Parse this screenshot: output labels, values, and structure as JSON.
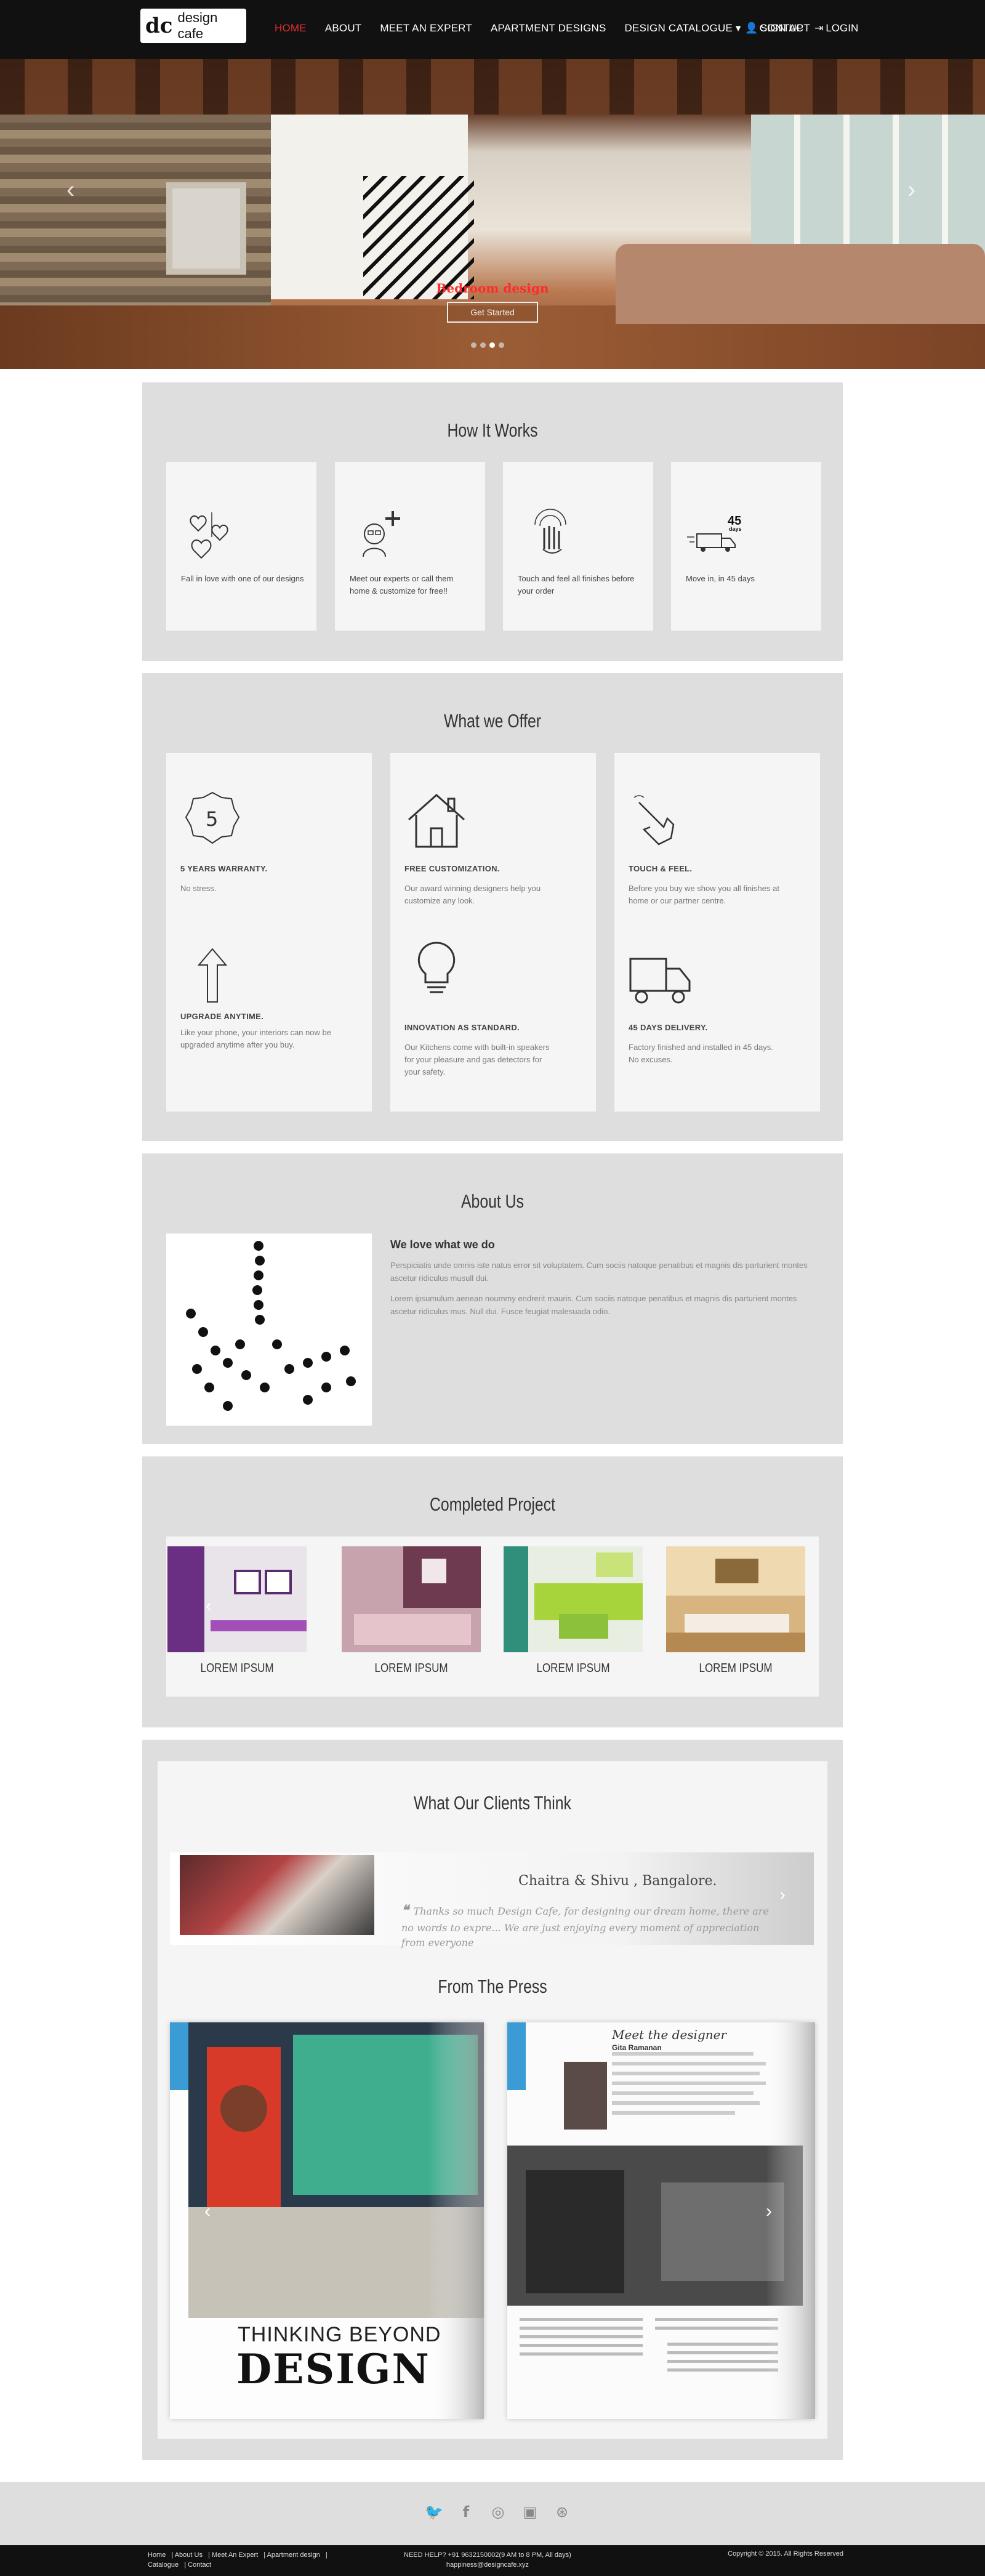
{
  "brand": {
    "mark": "dc",
    "name": "design cafe"
  },
  "nav": {
    "items": [
      {
        "label": "HOME",
        "active": true
      },
      {
        "label": "ABOUT"
      },
      {
        "label": "MEET AN EXPERT"
      },
      {
        "label": "APARTMENT DESIGNS"
      },
      {
        "label": "DESIGN CATALOGUE ▾"
      },
      {
        "label": "CONTACT"
      }
    ],
    "signup": "SIGN UP",
    "login": "LOGIN"
  },
  "hero": {
    "caption": "Bedroom design",
    "button": "Get Started",
    "slide_count": 4,
    "active_slide": 2
  },
  "how_it_works": {
    "title": "How It Works",
    "steps": [
      {
        "icon": "hearts-icon",
        "text": "Fall in love with one of our designs"
      },
      {
        "icon": "expert-plus-icon",
        "text": "Meet our experts or call them home & customize for free!!"
      },
      {
        "icon": "touch-hand-icon",
        "text": "Touch and feel all finishes before your order"
      },
      {
        "icon": "truck-45-days-icon",
        "text": "Move in, in 45 days"
      }
    ]
  },
  "offer": {
    "title": "What we Offer",
    "items": [
      {
        "icon": "warranty-5-icon",
        "heading": "5 YEARS WARRANTY.",
        "text": "No stress."
      },
      {
        "icon": "house-icon",
        "heading": "FREE CUSTOMIZATION.",
        "text": "Our award winning designers help you customize any look."
      },
      {
        "icon": "finger-touch-icon",
        "heading": "TOUCH & FEEL.",
        "text": "Before you buy we show you all finishes at home or our partner centre."
      },
      {
        "icon": "arrow-up-icon",
        "heading": "UPGRADE ANYTIME.",
        "text": "Like your phone, your interiors can now be upgraded anytime after you buy."
      },
      {
        "icon": "bulb-icon",
        "heading": "INNOVATION AS STANDARD.",
        "text": "Our Kitchens come with built-in speakers for your pleasure and gas detectors for your safety."
      },
      {
        "icon": "truck-icon",
        "heading": "45 DAYS DELIVERY.",
        "text": "Factory finished and installed in 45 days. No excuses."
      }
    ]
  },
  "about": {
    "title": "About Us",
    "heading": "We love what we do",
    "p1": "Perspiciatis unde omnis iste natus error sit voluptatem. Cum sociis natoque penatibus et magnis dis parturient montes ascetur ridiculus musull dui.",
    "p2": "Lorem ipsumulum aenean noummy endrerit mauris. Cum sociis natoque penatibus et magnis dis parturient montes ascetur ridiculus mus. Null dui. Fusce feugiat malesuada odio."
  },
  "projects": {
    "title": "Completed Project",
    "items": [
      {
        "label": "LOREM IPSUM",
        "color": "#7b3f8f"
      },
      {
        "label": "LOREM IPSUM",
        "color": "#8a4a5e"
      },
      {
        "label": "LOREM IPSUM",
        "color": "#9acd32"
      },
      {
        "label": "LOREM IPSUM",
        "color": "#c89a5a"
      }
    ]
  },
  "clients": {
    "title": "What Our Clients Think",
    "name": "Chaitra & Shivu , Bangalore.",
    "quote": "Thanks so much Design Cafe, for designing our dream home, there are no words to expre... We are just enjoying every moment of appreciation from everyone"
  },
  "press": {
    "title": "From The Press",
    "left_headline_1": "THINKING BEYOND",
    "left_headline_2": "DESIGN",
    "right_heading": "Meet the designer",
    "right_name": "Gita Ramanan"
  },
  "footer": {
    "social": [
      "twitter-icon",
      "facebook-icon",
      "dribbble-icon",
      "flickr-icon",
      "github-icon"
    ],
    "links": [
      "Home",
      "About Us",
      "Meet An Expert",
      "Apartment design",
      "Catalogue",
      "Contact"
    ],
    "help": "NEED HELP? +91 9632150002(9 AM to 8 PM, All days)",
    "email": "happiness@designcafe.xyz",
    "copyright": "Copyright © 2015. All Rights Reserved"
  }
}
